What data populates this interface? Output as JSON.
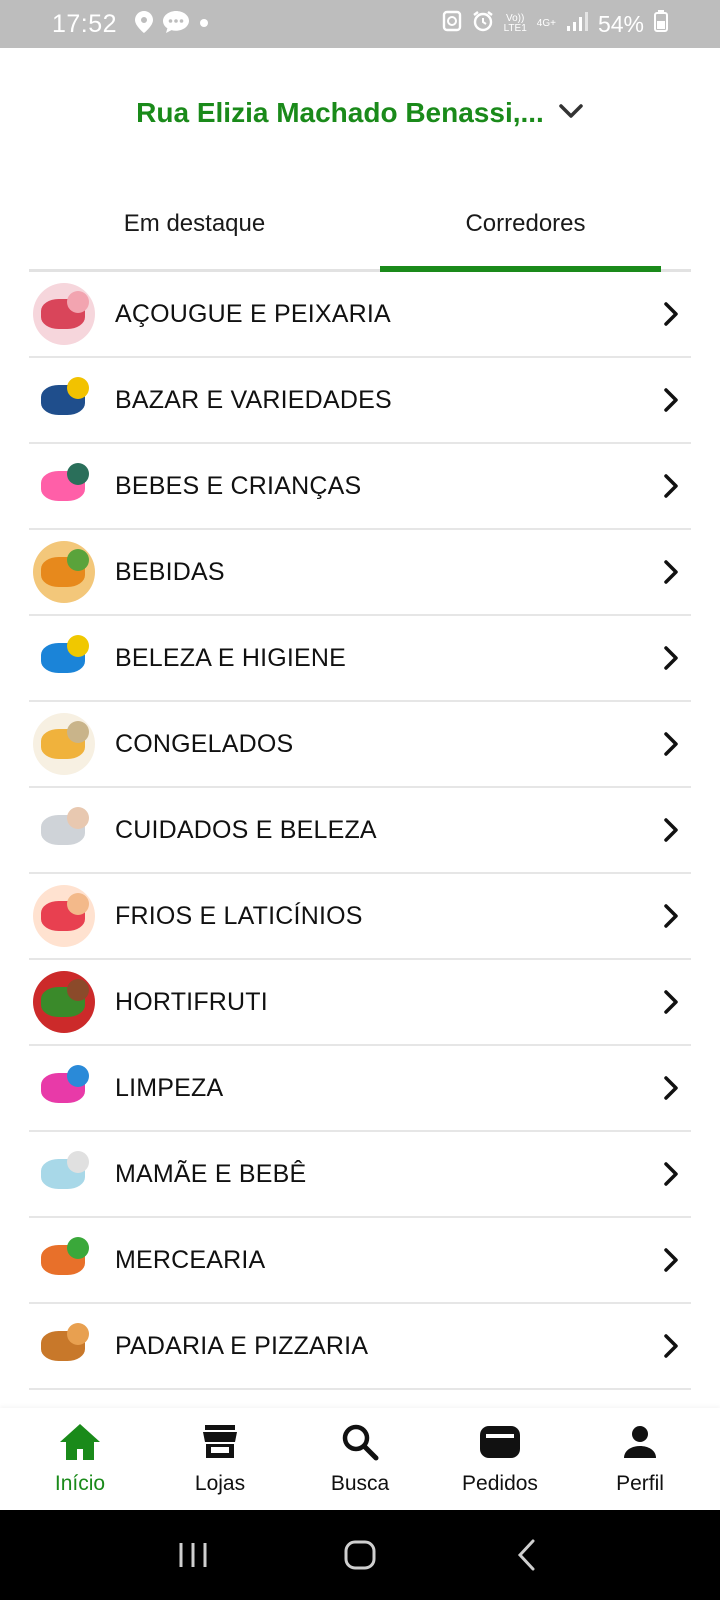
{
  "status_bar": {
    "time": "17:52",
    "battery": "54%",
    "volte_label": "Vo))\nLTE1",
    "network": "4G+"
  },
  "header": {
    "address": "Rua Elizia Machado Benassi,..."
  },
  "tabs": [
    {
      "label": "Em destaque",
      "active": false
    },
    {
      "label": "Corredores",
      "active": true
    }
  ],
  "categories": [
    {
      "label": "AÇOUGUE E PEIXARIA",
      "icon": "meat-icon",
      "colors": [
        "#f6d6dc",
        "#d9455a",
        "#f2a4b0"
      ]
    },
    {
      "label": "BAZAR E VARIEDADES",
      "icon": "bucket-mop-icon",
      "colors": [
        "#ffffff",
        "#1f4e8c",
        "#f2c200"
      ]
    },
    {
      "label": "BEBES E CRIANÇAS",
      "icon": "kids-toy-icon",
      "colors": [
        "#ffffff",
        "#ff5fa8",
        "#2a6f5a"
      ]
    },
    {
      "label": "BEBIDAS",
      "icon": "drinks-icon",
      "colors": [
        "#f3c77a",
        "#e7891c",
        "#5aa33b"
      ]
    },
    {
      "label": "BELEZA E HIGIENE",
      "icon": "hygiene-products-icon",
      "colors": [
        "#ffffff",
        "#1b84d8",
        "#f0c800"
      ]
    },
    {
      "label": "CONGELADOS",
      "icon": "frozen-food-icon",
      "colors": [
        "#f7f0e2",
        "#f0b23c",
        "#c9b48a"
      ]
    },
    {
      "label": "CUIDADOS E BELEZA",
      "icon": "beauty-care-icon",
      "colors": [
        "#ffffff",
        "#cfd3d8",
        "#e8c8b0"
      ]
    },
    {
      "label": "FRIOS E LATICÍNIOS",
      "icon": "cold-cuts-icon",
      "colors": [
        "#ffe2d0",
        "#e84050",
        "#f3b98a"
      ]
    },
    {
      "label": "HORTIFRUTI",
      "icon": "fruits-vegetables-icon",
      "colors": [
        "#cc2a2a",
        "#3a8a2a",
        "#8b4a2a"
      ]
    },
    {
      "label": "LIMPEZA",
      "icon": "cleaning-products-icon",
      "colors": [
        "#ffffff",
        "#e83aa8",
        "#2a8ad8"
      ]
    },
    {
      "label": "MAMÃE E BEBÊ",
      "icon": "diapers-icon",
      "colors": [
        "#ffffff",
        "#a8d8e8",
        "#e0e0e0"
      ]
    },
    {
      "label": "MERCEARIA",
      "icon": "grocery-icon",
      "colors": [
        "#ffffff",
        "#e8702a",
        "#3aa83a"
      ]
    },
    {
      "label": "PADARIA E PIZZARIA",
      "icon": "bread-icon",
      "colors": [
        "#ffffff",
        "#c8782a",
        "#e8a050"
      ]
    }
  ],
  "bottom_nav": [
    {
      "label": "Início",
      "icon": "home-icon",
      "active": true
    },
    {
      "label": "Lojas",
      "icon": "store-icon",
      "active": false
    },
    {
      "label": "Busca",
      "icon": "search-icon",
      "active": false
    },
    {
      "label": "Pedidos",
      "icon": "orders-icon",
      "active": false
    },
    {
      "label": "Perfil",
      "icon": "profile-icon",
      "active": false
    }
  ],
  "colors": {
    "accent": "#1a8a1a",
    "status_bar": "#bdbdbd",
    "divider": "#e6e6e6"
  }
}
